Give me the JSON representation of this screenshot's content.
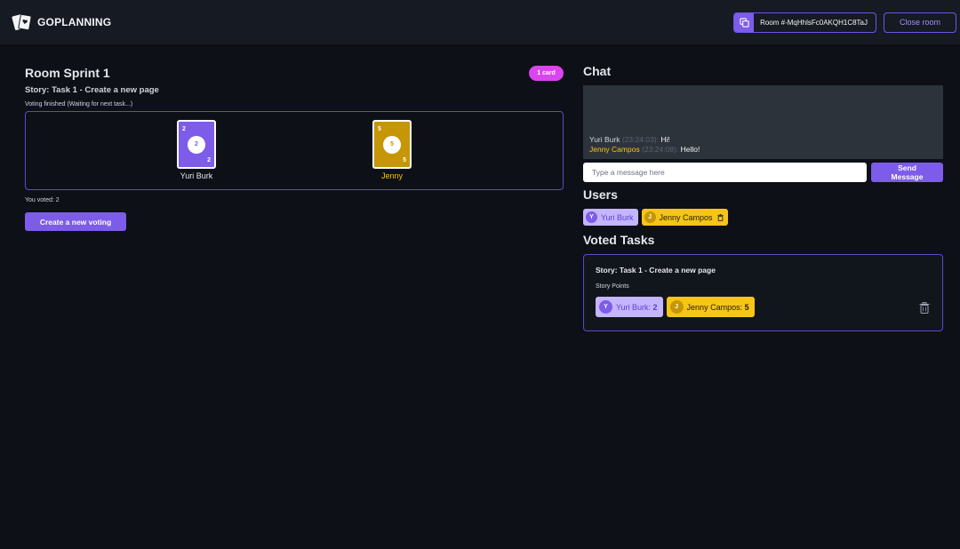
{
  "header": {
    "brand": "GOPLANNING",
    "room_id": "Room #-MqHhlsFc0AKQH1C8TaJ",
    "close_room": "Close room"
  },
  "room": {
    "title": "Room Sprint 1",
    "badge": "1 card",
    "story": "Story: Task 1 - Create a new page",
    "status": "Voting finished (Waiting for next task...)",
    "players": [
      {
        "name": "Yuri Burk",
        "vote": "2",
        "color": "#7c5ce9"
      },
      {
        "name": "Jenny",
        "vote": "5",
        "color": "#c59607"
      }
    ],
    "you_voted": "You voted: 2",
    "new_voting_button": "Create a new voting"
  },
  "chat": {
    "title": "Chat",
    "messages": [
      {
        "author": "Yuri Burk",
        "time": "(23:24:03):",
        "text": "Hi!"
      },
      {
        "author": "Jenny Campos",
        "time": "(23:24:08):",
        "text": "Hello!"
      }
    ],
    "input_placeholder": "Type a message here",
    "send_line1": "Send",
    "send_line2": "Message"
  },
  "users": {
    "title": "Users",
    "list": [
      {
        "initial": "Y",
        "name": "Yuri Burk"
      },
      {
        "initial": "J",
        "name": "Jenny Campos"
      }
    ]
  },
  "voted_tasks": {
    "title": "Voted Tasks",
    "items": [
      {
        "story": "Story: Task 1 - Create a new page",
        "points_label": "Story Points",
        "points": [
          {
            "initial": "Y",
            "name": "Yuri Burk:",
            "value": "2"
          },
          {
            "initial": "J",
            "name": "Jenny Campos:",
            "value": "5"
          }
        ]
      }
    ]
  },
  "colors": {
    "accent": "#7c5ce9",
    "gold": "#c59607",
    "badge": "#d946ef",
    "background": "#0d1016"
  }
}
